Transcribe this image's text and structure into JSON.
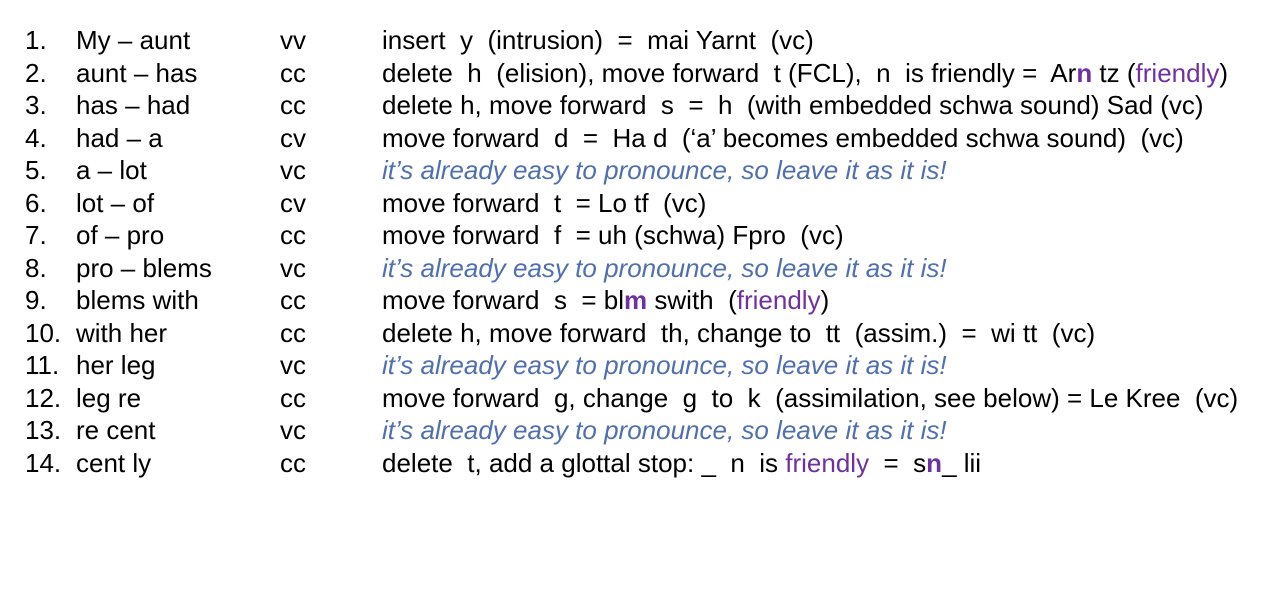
{
  "colors": {
    "text": "#000000",
    "friendly_purple": "#7030a0",
    "note_blue": "#4f6fae"
  },
  "rows": [
    {
      "number": "1.",
      "pair": "My – aunt",
      "type": "vv",
      "segments": [
        {
          "text": "insert  y  (intrusion)  =  mai Yarnt  (vc)",
          "style": "plain"
        }
      ]
    },
    {
      "number": "2.",
      "pair": "aunt – has",
      "type": "cc",
      "segments": [
        {
          "text": "delete  h  (elision), move forward  t (FCL),  n  is friendly =  Ar",
          "style": "plain"
        },
        {
          "text": "n",
          "style": "purple-bold"
        },
        {
          "text": " tz (",
          "style": "plain"
        },
        {
          "text": "friendly",
          "style": "purple"
        },
        {
          "text": ")",
          "style": "plain"
        }
      ]
    },
    {
      "number": "3.",
      "pair": "has – had",
      "type": "cc",
      "segments": [
        {
          "text": "delete h, move forward  s  =  h  (with embedded schwa sound) Sad (vc)",
          "style": "plain"
        }
      ]
    },
    {
      "number": "4.",
      "pair": "had – a",
      "type": "cv",
      "segments": [
        {
          "text": "move forward  d  =  Ha d  (‘a’ becomes embedded schwa sound)  (vc)",
          "style": "plain"
        }
      ]
    },
    {
      "number": "5.",
      "pair": "a – lot",
      "type": "vc",
      "segments": [
        {
          "text": "it’s already easy to pronounce, so leave it as it is!",
          "style": "blue-italic"
        }
      ]
    },
    {
      "number": "6.",
      "pair": "lot – of",
      "type": "cv",
      "segments": [
        {
          "text": "move forward  t  = Lo tf  (vc)",
          "style": "plain"
        }
      ]
    },
    {
      "number": "7.",
      "pair": "of – pro",
      "type": "cc",
      "segments": [
        {
          "text": "move forward  f  = uh (schwa) Fpro  (vc)",
          "style": "plain"
        }
      ]
    },
    {
      "number": "8.",
      "pair": "pro – blems",
      "type": "vc",
      "segments": [
        {
          "text": "it’s already easy to pronounce, so leave it as it is!",
          "style": "blue-italic"
        }
      ]
    },
    {
      "number": "9.",
      "pair": "blems with",
      "type": "cc",
      "segments": [
        {
          "text": "move forward  s  = bl",
          "style": "plain"
        },
        {
          "text": "m",
          "style": "purple-bold"
        },
        {
          "text": " swith  (",
          "style": "plain"
        },
        {
          "text": "friendly",
          "style": "purple"
        },
        {
          "text": ")",
          "style": "plain"
        }
      ]
    },
    {
      "number": "10.",
      "pair": "with her",
      "type": "cc",
      "segments": [
        {
          "text": "delete h, move forward  th, change to  tt  (assim.)  =  wi tt  (vc)",
          "style": "plain"
        }
      ]
    },
    {
      "number": "11.",
      "pair": "her leg",
      "type": "vc",
      "segments": [
        {
          "text": "it’s already easy to pronounce, so leave it as it is!",
          "style": "blue-italic"
        }
      ]
    },
    {
      "number": "12.",
      "pair": "leg re",
      "type": "cc",
      "segments": [
        {
          "text": "move forward  g, change  g  to  k  (assimilation, see below) = Le Kree  (vc)",
          "style": "plain"
        }
      ]
    },
    {
      "number": "13.",
      "pair": "re cent",
      "type": "vc",
      "segments": [
        {
          "text": "it’s already easy to pronounce, so leave it as it is!",
          "style": "blue-italic"
        }
      ]
    },
    {
      "number": "14.",
      "pair": "cent ly",
      "type": "cc",
      "segments": [
        {
          "text": "delete  t, add a glottal stop: _  n  is ",
          "style": "plain"
        },
        {
          "text": "friendly",
          "style": "purple"
        },
        {
          "text": "  =  s",
          "style": "plain"
        },
        {
          "text": "n",
          "style": "purple-bold"
        },
        {
          "text": "_ lii",
          "style": "plain"
        }
      ]
    }
  ]
}
